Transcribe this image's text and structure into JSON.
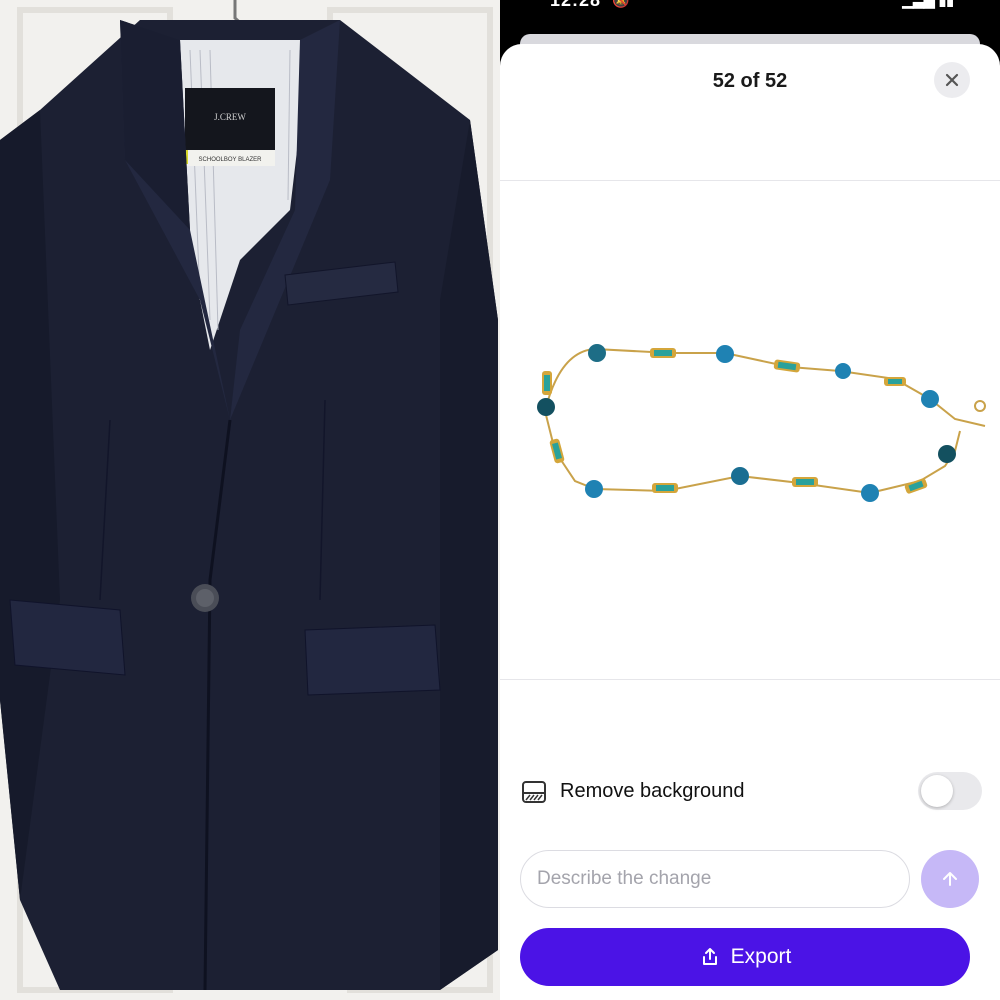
{
  "status_bar": {
    "time": "12:28"
  },
  "sheet": {
    "title": "52 of 52",
    "close_icon": "close-icon"
  },
  "photo_left": {
    "label_brand": "J.CREW",
    "label_style": "SCHOOLBOY BLAZER"
  },
  "preview": {
    "subject_icon": "necklace-image"
  },
  "remove_background": {
    "label": "Remove background",
    "enabled": false,
    "icon": "remove-background-icon"
  },
  "prompt": {
    "placeholder": "Describe the change",
    "value": "",
    "send_icon": "arrow-up-icon"
  },
  "export_button": {
    "label": "Export",
    "icon": "share-icon"
  },
  "colors": {
    "accent": "#4b13e6",
    "send_disabled": "#c6b8f7",
    "blazer": "#1c2033"
  }
}
